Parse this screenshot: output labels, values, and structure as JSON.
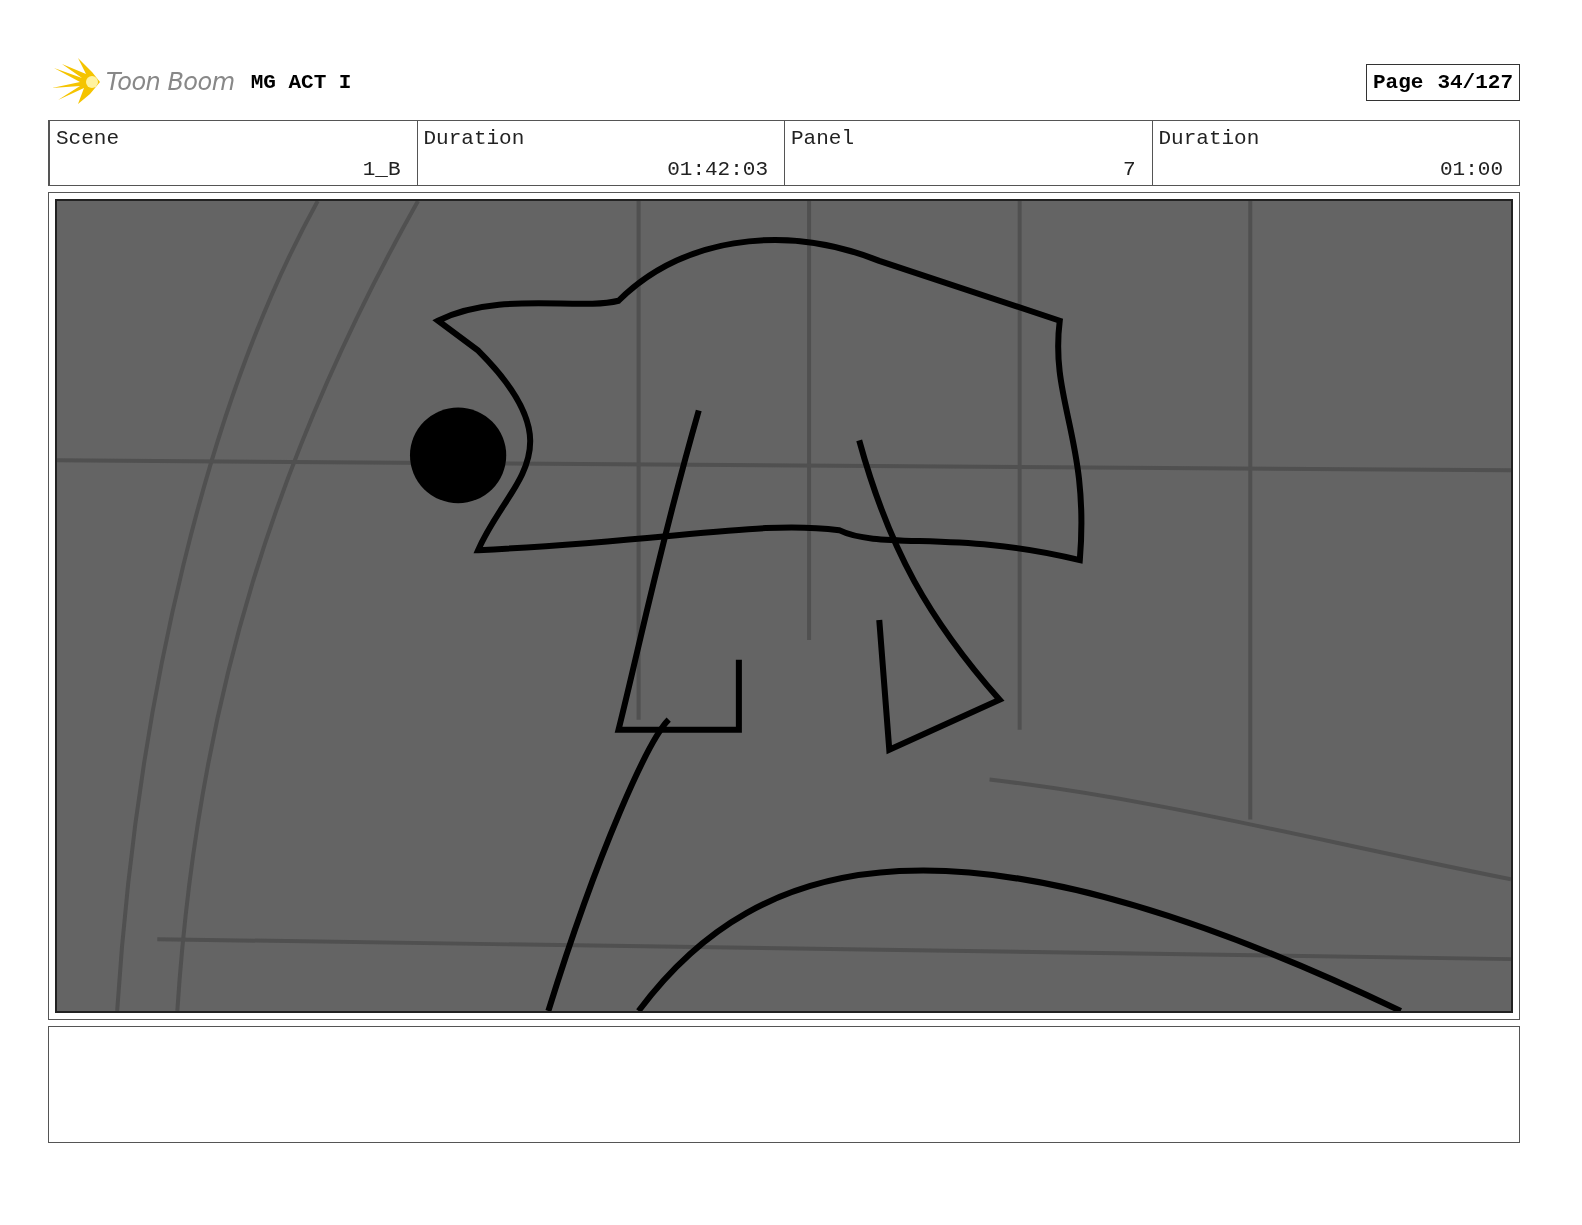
{
  "header": {
    "logo_text": "Toon Boom",
    "project": "MG ACT I",
    "page_label": "Page",
    "page_number": "34/127"
  },
  "info": [
    {
      "label": "Scene",
      "value": "1_B"
    },
    {
      "label": "Duration",
      "value": "01:42:03"
    },
    {
      "label": "Panel",
      "value": "7"
    },
    {
      "label": "Duration",
      "value": "01:00"
    }
  ]
}
